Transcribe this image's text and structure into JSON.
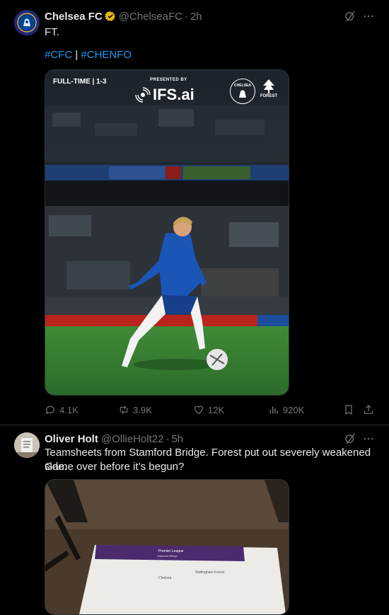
{
  "tweets": [
    {
      "name": "Chelsea FC",
      "handle": "@ChelseaFC",
      "time": "2h",
      "text": "FT.",
      "hashtags": [
        "#CFC",
        "#CHENFO"
      ],
      "hashtag_separator": "|",
      "media": {
        "score_label": "FULL-TIME | 1-3",
        "presented_by": "PRESENTED BY",
        "sponsor": "IFS.ai",
        "crest_text": "CHELSEA",
        "forest_text": "FOREST"
      },
      "stats": {
        "replies": "4.1K",
        "reposts": "3.9K",
        "likes": "12K",
        "views": "920K"
      }
    },
    {
      "name": "Oliver Holt",
      "handle": "@OllieHolt22",
      "time": "5h",
      "text_line1": "Teamsheets from Stamford Bridge. Forest put out severely weakened side.",
      "text_line2": "Game over before it’s begun?",
      "media": {
        "sheet_league": "Premier League",
        "sheet_venue": "Stamford Bridge",
        "home_team": "Chelsea",
        "away_team": "Nottingham Forest"
      }
    }
  ],
  "colors": {
    "accent": "#1d9bf0",
    "verified": "#e2b719",
    "muted": "#71767b",
    "background": "#000000"
  }
}
